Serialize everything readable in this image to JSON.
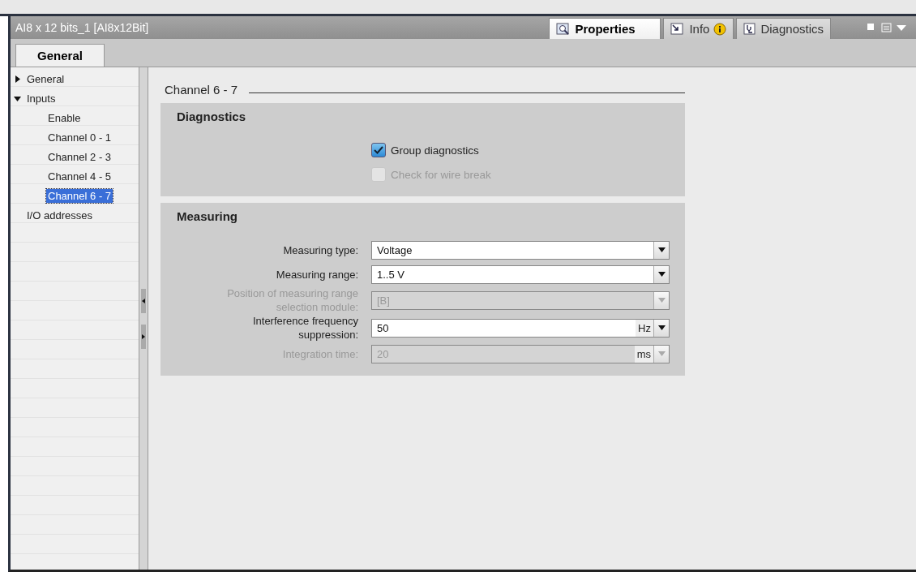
{
  "panel": {
    "title": "AI8 x 12 bits_1 [AI8x12Bit]",
    "tabs": [
      {
        "label": "Properties",
        "selected": true,
        "kind": "properties"
      },
      {
        "label": "Info",
        "selected": false,
        "kind": "info"
      },
      {
        "label": "Diagnostics",
        "selected": false,
        "kind": "diagnostics"
      }
    ]
  },
  "subtabs": [
    {
      "label": "General",
      "selected": true
    }
  ],
  "nav": [
    {
      "label": "General",
      "expanded": false,
      "selected": false
    },
    {
      "label": "Inputs",
      "expanded": true,
      "selected": false,
      "children": [
        {
          "label": "Enable",
          "selected": false
        },
        {
          "label": "Channel 0 - 1",
          "selected": false
        },
        {
          "label": "Channel 2 - 3",
          "selected": false
        },
        {
          "label": "Channel 4 - 5",
          "selected": false
        },
        {
          "label": "Channel 6 - 7",
          "selected": true
        }
      ]
    },
    {
      "label": "I/O addresses",
      "selected": false
    }
  ],
  "section_title": "Channel 6 - 7",
  "groups": [
    {
      "title": "Diagnostics",
      "rows": [
        {
          "kind": "checkbox",
          "label": "Group diagnostics",
          "checked": true,
          "disabled": false
        },
        {
          "kind": "checkbox",
          "label": "Check for wire break",
          "checked": false,
          "disabled": true
        }
      ]
    },
    {
      "title": "Measuring",
      "rows": [
        {
          "kind": "select",
          "label": "Measuring type:",
          "value": "Voltage",
          "disabled": false
        },
        {
          "kind": "select",
          "label": "Measuring range:",
          "value": "1..5 V",
          "disabled": false
        },
        {
          "kind": "select",
          "label": "Position of measuring range selection module:",
          "value": "[B]",
          "disabled": true
        },
        {
          "kind": "unit-select",
          "label": "Interference frequency suppression:",
          "value": "50",
          "unit": "Hz",
          "disabled": false
        },
        {
          "kind": "unit-select",
          "label": "Integration time:",
          "value": "20",
          "unit": "ms",
          "disabled": true
        }
      ]
    }
  ]
}
